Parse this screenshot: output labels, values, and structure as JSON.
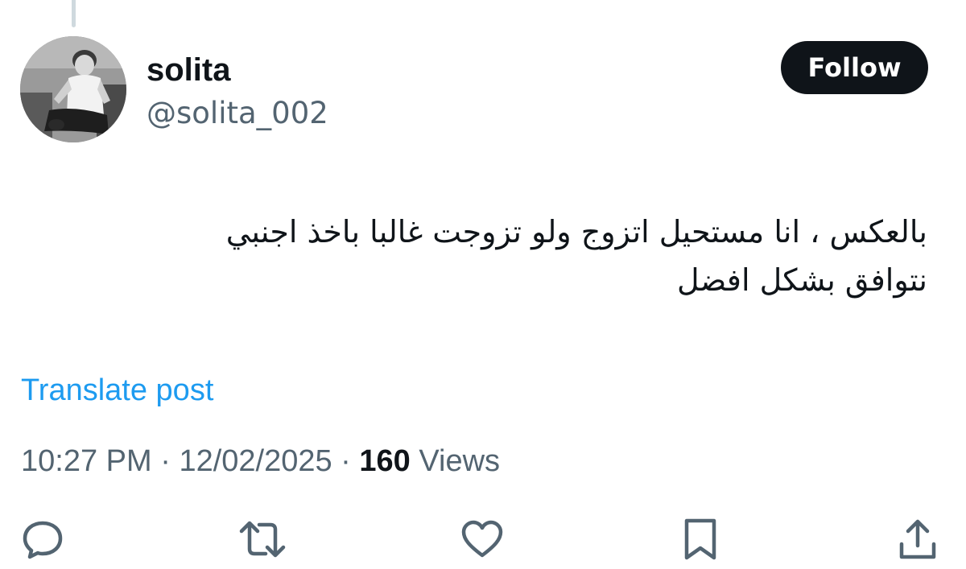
{
  "author": {
    "display_name": "solita",
    "handle": "@solita_002",
    "avatar_icon": "profile-photo"
  },
  "follow_button": {
    "label": "Follow"
  },
  "post": {
    "text": "بالعكس ، انا مستحيل اتزوج ولو تزوجت غالبا باخذ اجنبي\nنتوافق بشكل افضل"
  },
  "translate": {
    "label": "Translate post"
  },
  "meta": {
    "time": "10:27 PM",
    "separator1": " · ",
    "date": "12/02/2025",
    "separator2": " · ",
    "views_count": "160",
    "views_label": " Views"
  },
  "actions": [
    {
      "icon": "reply-icon"
    },
    {
      "icon": "repost-icon"
    },
    {
      "icon": "like-icon"
    },
    {
      "icon": "bookmark-icon"
    },
    {
      "icon": "share-icon"
    }
  ],
  "colors": {
    "text_primary": "#0f1419",
    "text_secondary": "#536471",
    "link": "#1d9bf0",
    "button_bg": "#0f1419",
    "button_text": "#ffffff"
  }
}
